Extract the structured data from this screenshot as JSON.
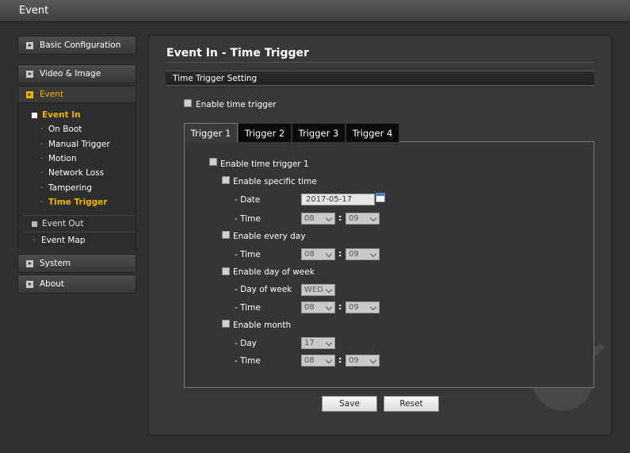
{
  "window": {
    "title": "Event"
  },
  "sidebar": {
    "basic_configuration": "Basic Configuration",
    "video_image": "Video & Image",
    "event": "Event",
    "event_in": "Event In",
    "event_in_items": [
      "On Boot",
      "Manual Trigger",
      "Motion",
      "Network Loss",
      "Tampering",
      "Time Trigger"
    ],
    "event_out": "Event Out",
    "event_map": "Event Map",
    "system": "System",
    "about": "About"
  },
  "main": {
    "title": "Event In - Time Trigger",
    "section": "Time Trigger Setting",
    "enable_time_trigger": "Enable time trigger",
    "tabs": [
      "Trigger 1",
      "Trigger 2",
      "Trigger 3",
      "Trigger 4"
    ],
    "enable_trigger": "Enable time trigger 1",
    "specific": {
      "label": "Enable specific time",
      "date_label": "- Date",
      "date_value": "2017-05-17",
      "time_label": "- Time",
      "hour": "08",
      "minute": "09"
    },
    "every_day": {
      "label": "Enable every day",
      "time_label": "- Time",
      "hour": "08",
      "minute": "09"
    },
    "day_of_week": {
      "label": "Enable day of week",
      "dow_label": "- Day of week",
      "dow_value": "WED",
      "time_label": "- Time",
      "hour": "08",
      "minute": "09"
    },
    "month": {
      "label": "Enable month",
      "day_label": "- Day",
      "day_value": "17",
      "time_label": "- Time",
      "hour": "08",
      "minute": "09"
    },
    "colon": ":",
    "save": "Save",
    "reset": "Reset"
  },
  "colors": {
    "accent": "#f0b400",
    "background": "#303030",
    "panel": "#383838"
  }
}
